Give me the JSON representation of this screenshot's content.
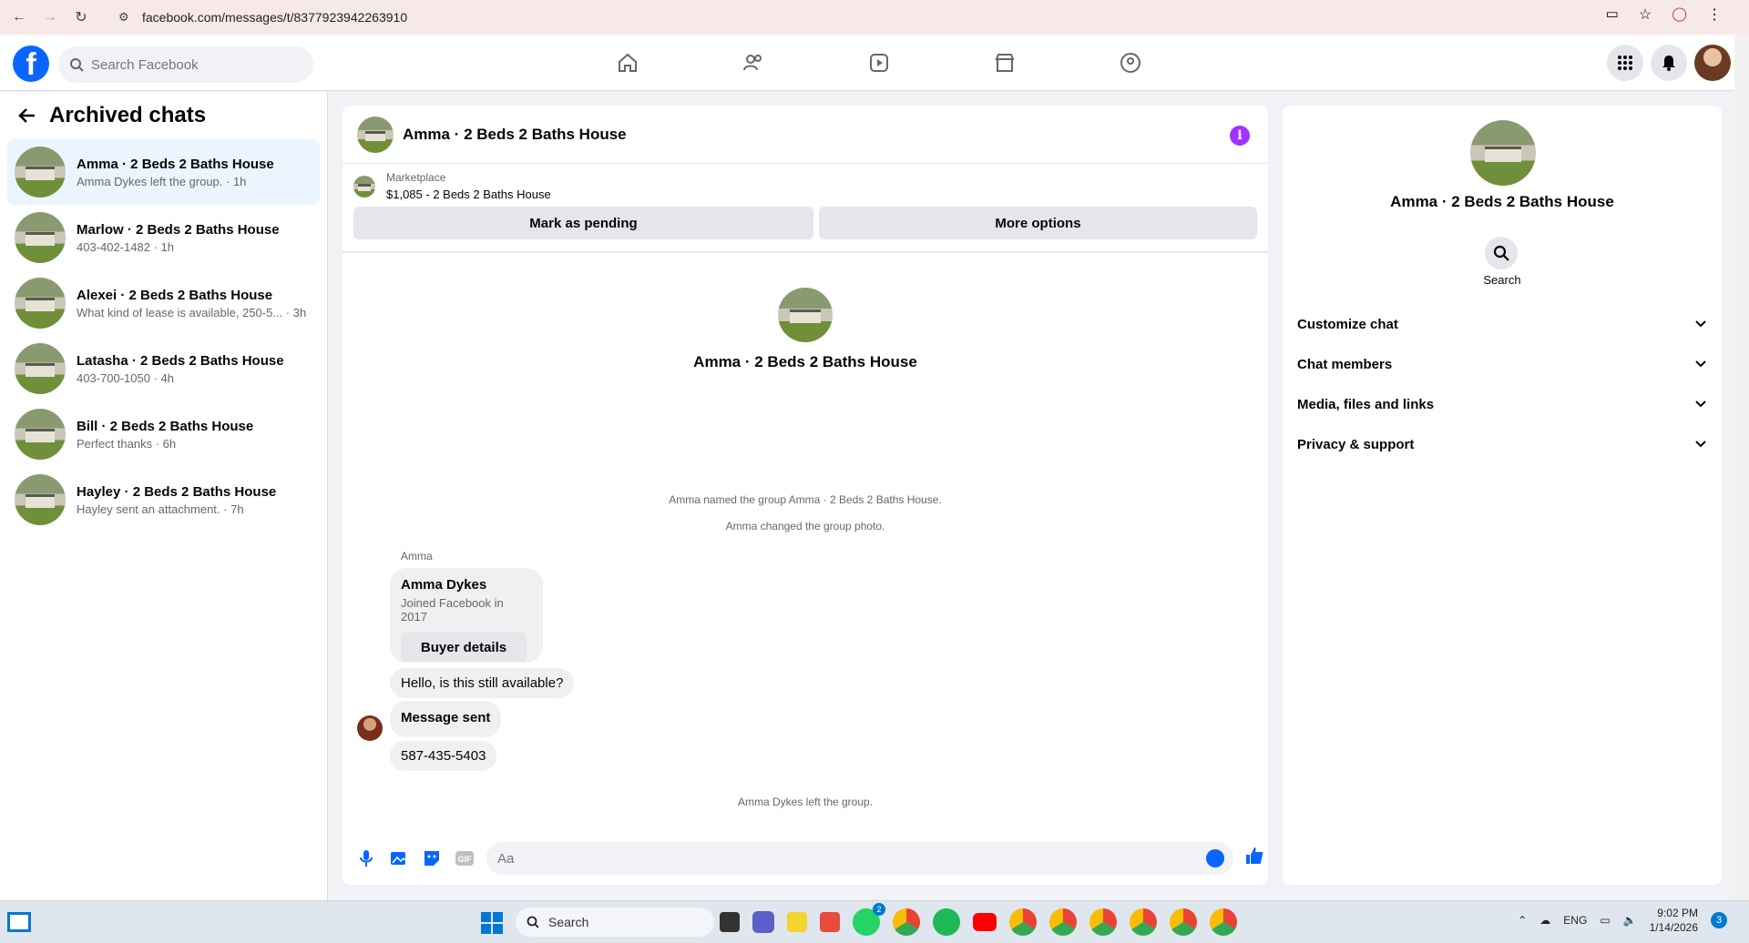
{
  "browser": {
    "url": "facebook.com/messages/t/8377923942263910"
  },
  "header": {
    "search_placeholder": "Search Facebook"
  },
  "sidebar": {
    "title": "Archived chats",
    "chats": [
      {
        "name": "Amma · 2 Beds 2 Baths House",
        "preview": "Amma Dykes left the group. · 1h",
        "active": true
      },
      {
        "name": "Marlow · 2 Beds 2 Baths House",
        "preview": "403-402-1482 · 1h",
        "active": false
      },
      {
        "name": "Alexei · 2 Beds 2 Baths House",
        "preview": "What kind of lease is available, 250-5... · 3h",
        "active": false
      },
      {
        "name": "Latasha · 2 Beds 2 Baths House",
        "preview": "403-700-1050 · 4h",
        "active": false
      },
      {
        "name": "Bill · 2 Beds 2 Baths House",
        "preview": "Perfect thanks · 6h",
        "active": false
      },
      {
        "name": "Hayley · 2 Beds 2 Baths House",
        "preview": "Hayley sent an attachment. · 7h",
        "active": false
      }
    ]
  },
  "chat": {
    "title": "Amma · 2 Beds 2 Baths House",
    "marketplace_label": "Marketplace",
    "listing": "$1,085 - 2 Beds 2 Baths House",
    "mark_pending": "Mark as pending",
    "more_options": "More options",
    "group_name": "Amma · 2 Beds 2 Baths House",
    "system_1": "Amma named the group Amma · 2 Beds 2 Baths House.",
    "system_2": "Amma changed the group photo.",
    "sender": "Amma",
    "buyer_name": "Amma Dykes",
    "buyer_joined": "Joined Facebook in 2017",
    "buyer_details": "Buyer details",
    "msg_1": "Hello, is this still available?",
    "msg_2": "Message sent",
    "msg_3": "587-435-5403",
    "system_3": "Amma Dykes left the group.",
    "composer_placeholder": "Aa"
  },
  "details": {
    "name": "Amma · 2 Beds 2 Baths House",
    "search_label": "Search",
    "sections": [
      "Customize chat",
      "Chat members",
      "Media, files and links",
      "Privacy & support"
    ]
  },
  "taskbar": {
    "search_label": "Search",
    "lang": "ENG",
    "time": "9:02 PM",
    "date": "1/14/2026",
    "notif_count": "3",
    "whatsapp_badge": "2"
  },
  "colors": {
    "fb_blue": "#0866ff",
    "active_chat_bg": "#ebf5ff",
    "info_purple": "#a033ff"
  }
}
